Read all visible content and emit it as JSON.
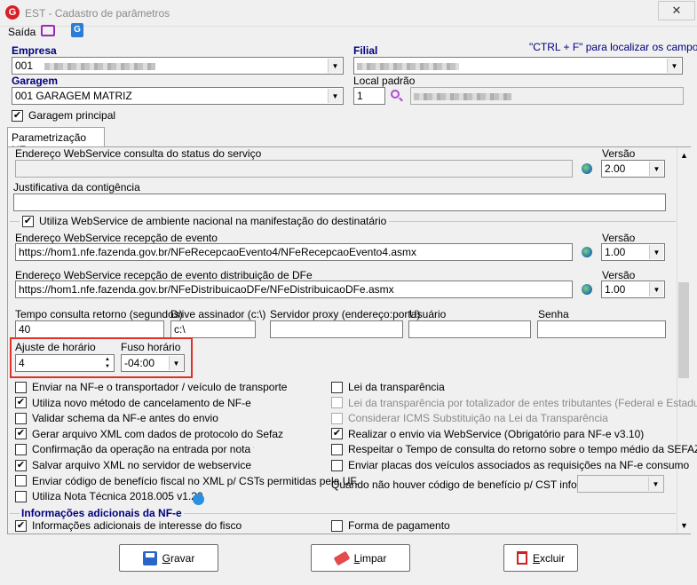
{
  "window": {
    "title": "EST - Cadastro de parâmetros",
    "close_glyph": "✕"
  },
  "menu": {
    "saida": "Saída"
  },
  "header": {
    "empresa_label": "Empresa",
    "empresa_value": "001",
    "filial_label": "Filial",
    "hint": "\"CTRL + F\" para localizar os campos",
    "garagem_label": "Garagem",
    "garagem_value": "001 GARAGEM MATRIZ",
    "local_label": "Local padrão",
    "local_value": "1",
    "garagem_principal": "Garagem principal"
  },
  "tab": {
    "label": "Parametrização NF-e"
  },
  "ws": {
    "status_label": "Endereço WebService consulta do status do serviço",
    "versao_label": "Versão",
    "status_versao": "2.00",
    "justificativa_label": "Justificativa da contigência",
    "nacional_label": "Utiliza WebService de ambiente nacional na manifestação do destinatário",
    "evento_label": "Endereço WebService recepção de evento",
    "evento_url": "https://hom1.nfe.fazenda.gov.br/NFeRecepcaoEvento4/NFeRecepcaoEvento4.asmx",
    "evento_versao": "1.00",
    "dfe_label": "Endereço WebService recepção de evento distribuição de DFe",
    "dfe_url": "https://hom1.nfe.fazenda.gov.br/NFeDistribuicaoDFe/NFeDistribuicaoDFe.asmx",
    "dfe_versao": "1.00"
  },
  "misc": {
    "tempo_label": "Tempo consulta retorno (segundos)",
    "tempo_value": "40",
    "drive_label": "Drive assinador (c:\\)",
    "drive_value": "c:\\",
    "proxy_label": "Servidor proxy (endereço:porta)",
    "usuario_label": "Usuário",
    "senha_label": "Senha",
    "ajuste_label": "Ajuste de horário",
    "ajuste_value": "4",
    "fuso_label": "Fuso horário",
    "fuso_value": "-04:00"
  },
  "checks_left": [
    {
      "label": "Enviar na NF-e o transportador / veículo de transporte",
      "checked": false
    },
    {
      "label": "Utiliza novo método de cancelamento de NF-e",
      "checked": true
    },
    {
      "label": "Validar schema da NF-e antes do envio",
      "checked": false
    },
    {
      "label": "Gerar arquivo XML com dados de protocolo do Sefaz",
      "checked": true
    },
    {
      "label": "Confirmação da operação na entrada por nota fiscal eletrônica",
      "checked": false
    },
    {
      "label": "Salvar arquivo XML no servidor de webservice",
      "checked": true
    },
    {
      "label": "Enviar código de benefício fiscal no XML p/ CSTs permitidas pela UF.",
      "checked": false
    },
    {
      "label": "Utiliza Nota Técnica 2018.005 v1.20",
      "checked": false
    }
  ],
  "checks_right": [
    {
      "label": "Lei da transparência",
      "checked": false,
      "disabled": false
    },
    {
      "label": "Lei da transparência por totalizador de entes tributantes (Federal e Estadual)",
      "checked": false,
      "disabled": true
    },
    {
      "label": "Considerar ICMS Substituição na Lei da Transparência",
      "checked": false,
      "disabled": true
    },
    {
      "label": "Realizar o envio via WebService (Obrigatório para NF-e v3.10)",
      "checked": true,
      "disabled": false
    },
    {
      "label": "Respeitar o Tempo de consulta do retorno sobre o tempo médio da SEFAZ",
      "checked": false,
      "disabled": false
    },
    {
      "label": "Enviar placas dos veículos associados as requisições na NF-e consumo",
      "checked": false,
      "disabled": false
    }
  ],
  "beneficio_label": "Quando não houver código de benefício p/ CST informar",
  "info": {
    "section_title": "Informações adicionais da NF-e",
    "info_fisco": "Informações adicionais de interesse do fisco",
    "forma_pagamento": "Forma de pagamento"
  },
  "buttons": {
    "gravar_pre": "",
    "gravar_u": "G",
    "gravar_post": "ravar",
    "limpar_u": "L",
    "limpar_post": "impar",
    "excluir_u": "E",
    "excluir_post": "xcluir"
  },
  "colors": {
    "accent": "#000080",
    "highlight": "#e0302a"
  }
}
